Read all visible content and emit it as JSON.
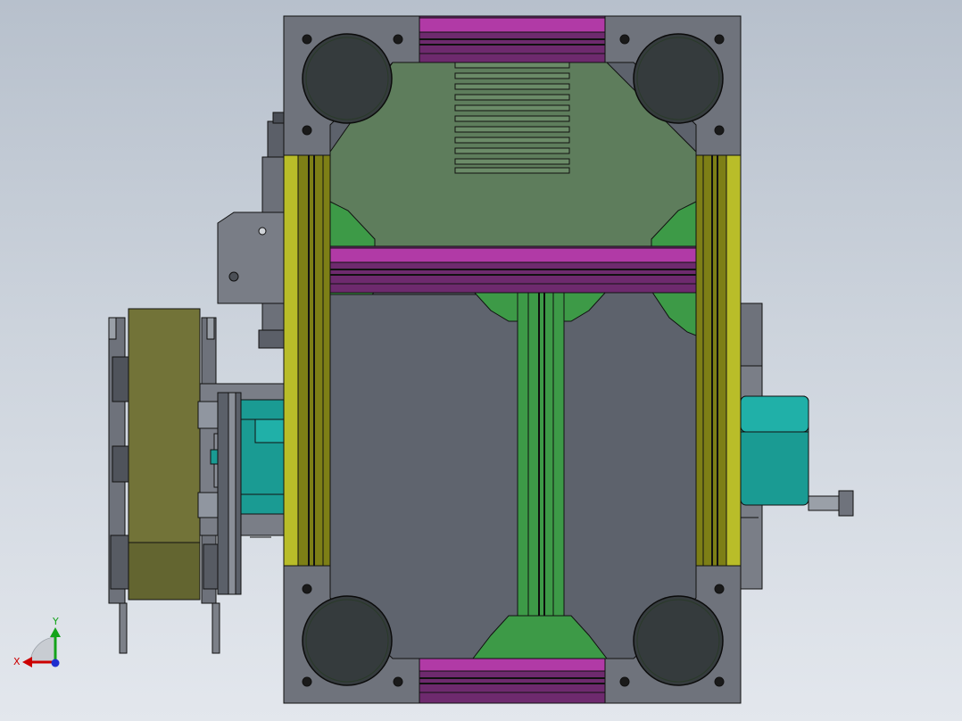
{
  "colors": {
    "background_top": "#b7c0cc",
    "background_bottom": "#e3e7ed",
    "frame_gray": "#5d626c",
    "corner_plate": "#6f737c",
    "pulley_dark": "#353b3d",
    "plate_green": "#5e7d5c",
    "bracket_green": "#3d9a47",
    "rail_purple": "#6e2a6e",
    "rail_purple_light": "#b13aa6",
    "rail_olive": "#7d7f16",
    "rail_olive_light": "#b9bd29",
    "belt_olive": "#727338",
    "motor_teal": "#1a9b93",
    "outline": "#111111",
    "triad_x": "#cc0000",
    "triad_y": "#13a31a",
    "triad_z": "#1f2fcf"
  },
  "triad": {
    "x_label": "X",
    "y_label": "Y",
    "x_icon": "x-axis-arrow-icon",
    "y_icon": "y-axis-arrow-icon"
  }
}
